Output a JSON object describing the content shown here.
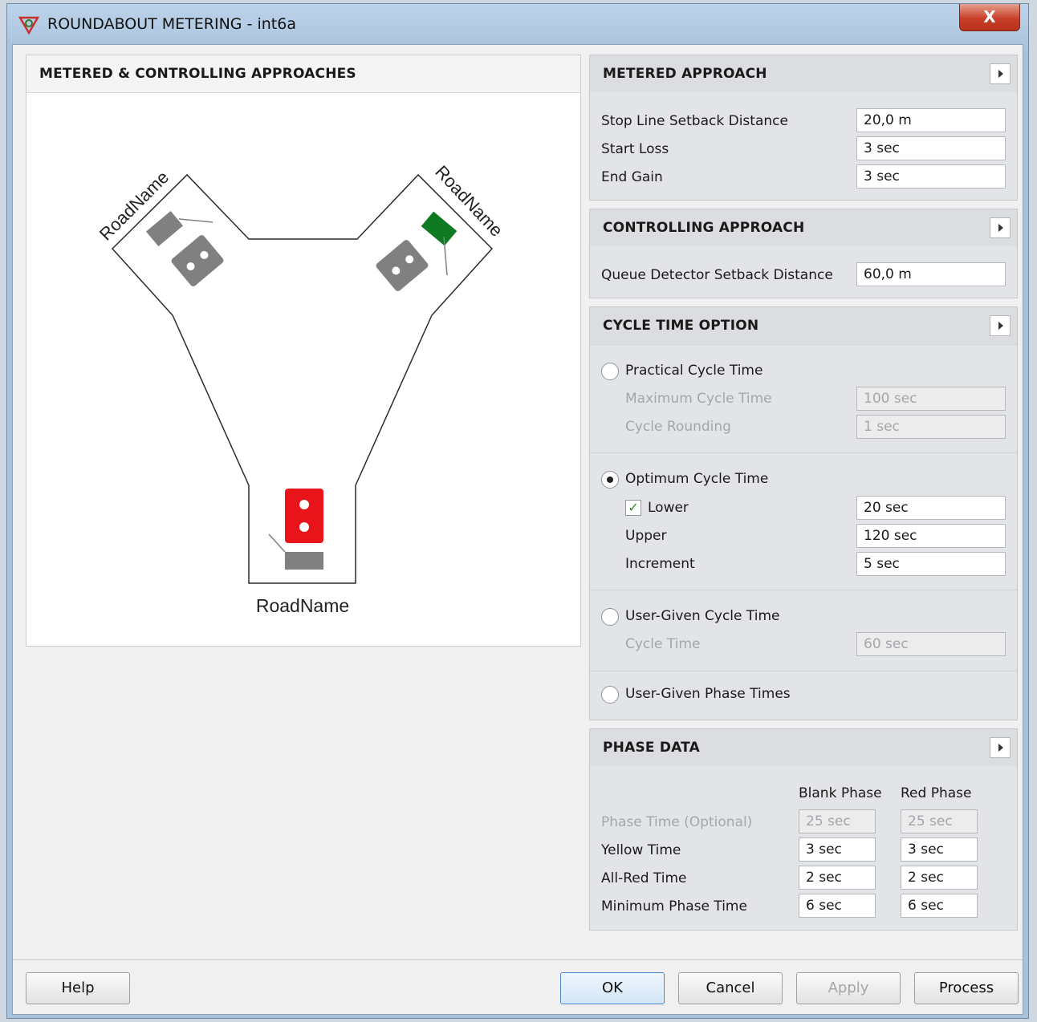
{
  "window": {
    "title": "ROUNDABOUT METERING - int6a",
    "close_label": "X",
    "title_icon": "roundabout-app-icon"
  },
  "diagram": {
    "header": "METERED & CONTROLLING APPROACHES",
    "road_left": "RoadName",
    "road_right": "RoadName",
    "road_bottom": "RoadName",
    "colors": {
      "red_signal": "#e8141a",
      "green_signal": "#0f7a22",
      "grey_signal": "#808080"
    }
  },
  "metered": {
    "header": "METERED APPROACH",
    "rows": [
      {
        "label": "Stop Line Setback Distance",
        "value": "20,0 m"
      },
      {
        "label": "Start Loss",
        "value": "3 sec"
      },
      {
        "label": "End Gain",
        "value": "3 sec"
      }
    ]
  },
  "controlling": {
    "header": "CONTROLLING APPROACH",
    "rows": [
      {
        "label": "Queue Detector Setback Distance",
        "value": "60,0 m"
      }
    ]
  },
  "cycle": {
    "header": "CYCLE TIME OPTION",
    "practical": {
      "label": "Practical Cycle Time",
      "selected": false,
      "rows": [
        {
          "label": "Maximum Cycle Time",
          "value": "100 sec"
        },
        {
          "label": "Cycle Rounding",
          "value": "1 sec"
        }
      ]
    },
    "optimum": {
      "label": "Optimum Cycle Time",
      "selected": true,
      "lower_label": "Lower",
      "lower_checked": true,
      "lower_value": "20 sec",
      "upper_label": "Upper",
      "upper_value": "120 sec",
      "increment_label": "Increment",
      "increment_value": "5 sec"
    },
    "user_cycle": {
      "label": "User-Given Cycle Time",
      "selected": false,
      "cycle_label": "Cycle Time",
      "cycle_value": "60 sec"
    },
    "user_phase": {
      "label": "User-Given Phase Times",
      "selected": false
    }
  },
  "phase": {
    "header": "PHASE DATA",
    "col_blank": "Blank Phase",
    "col_red": "Red Phase",
    "rows": [
      {
        "label": "Phase Time (Optional)",
        "blank": "25 sec",
        "red": "25 sec"
      },
      {
        "label": "Yellow Time",
        "blank": "3 sec",
        "red": "3 sec"
      },
      {
        "label": "All-Red Time",
        "blank": "2 sec",
        "red": "2 sec"
      },
      {
        "label": "Minimum Phase Time",
        "blank": "6 sec",
        "red": "6 sec"
      }
    ]
  },
  "buttons": {
    "help": "Help",
    "ok": "OK",
    "cancel": "Cancel",
    "apply": "Apply",
    "process": "Process"
  }
}
